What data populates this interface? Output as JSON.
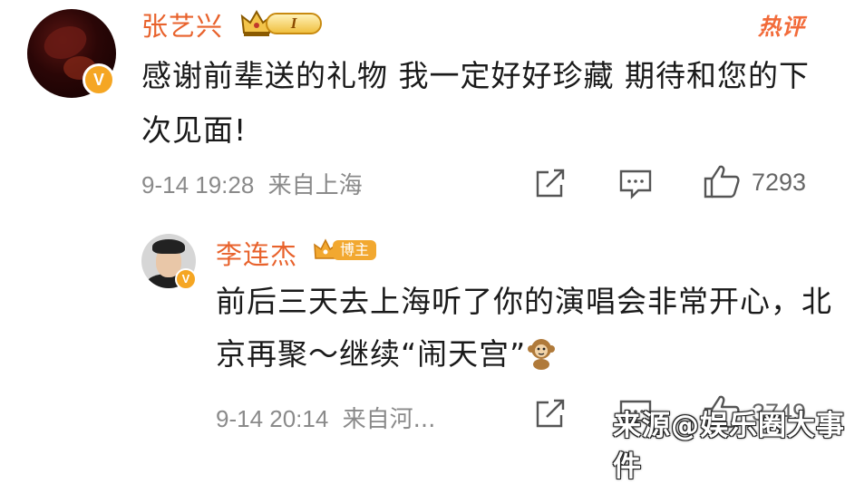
{
  "comment": {
    "author": "张艺兴",
    "level_badge": "I",
    "hot_label": "热评",
    "text": "感谢前辈送的礼物 我一定好好珍藏 期待和您的下次见面!",
    "time": "9-14 19:28",
    "location": "来自上海",
    "likes": "7293",
    "verified_mark": "V"
  },
  "reply": {
    "author": "李连杰",
    "role_badge": "博主",
    "text": "前后三天去上海听了你的演唱会非常开心，北京再聚～继续“闹天宫”",
    "time": "9-14 20:14",
    "location": "来自河...",
    "likes": "3749",
    "verified_mark": "V"
  },
  "watermark": "来源@娱乐圈大事件",
  "colors": {
    "name": "#e8622c",
    "hot": "#f26b3a",
    "meta": "#8a8a8a",
    "vip": "#f5a623"
  },
  "icons": [
    "share-icon",
    "comment-icon",
    "like-icon",
    "monkey-emoji"
  ]
}
